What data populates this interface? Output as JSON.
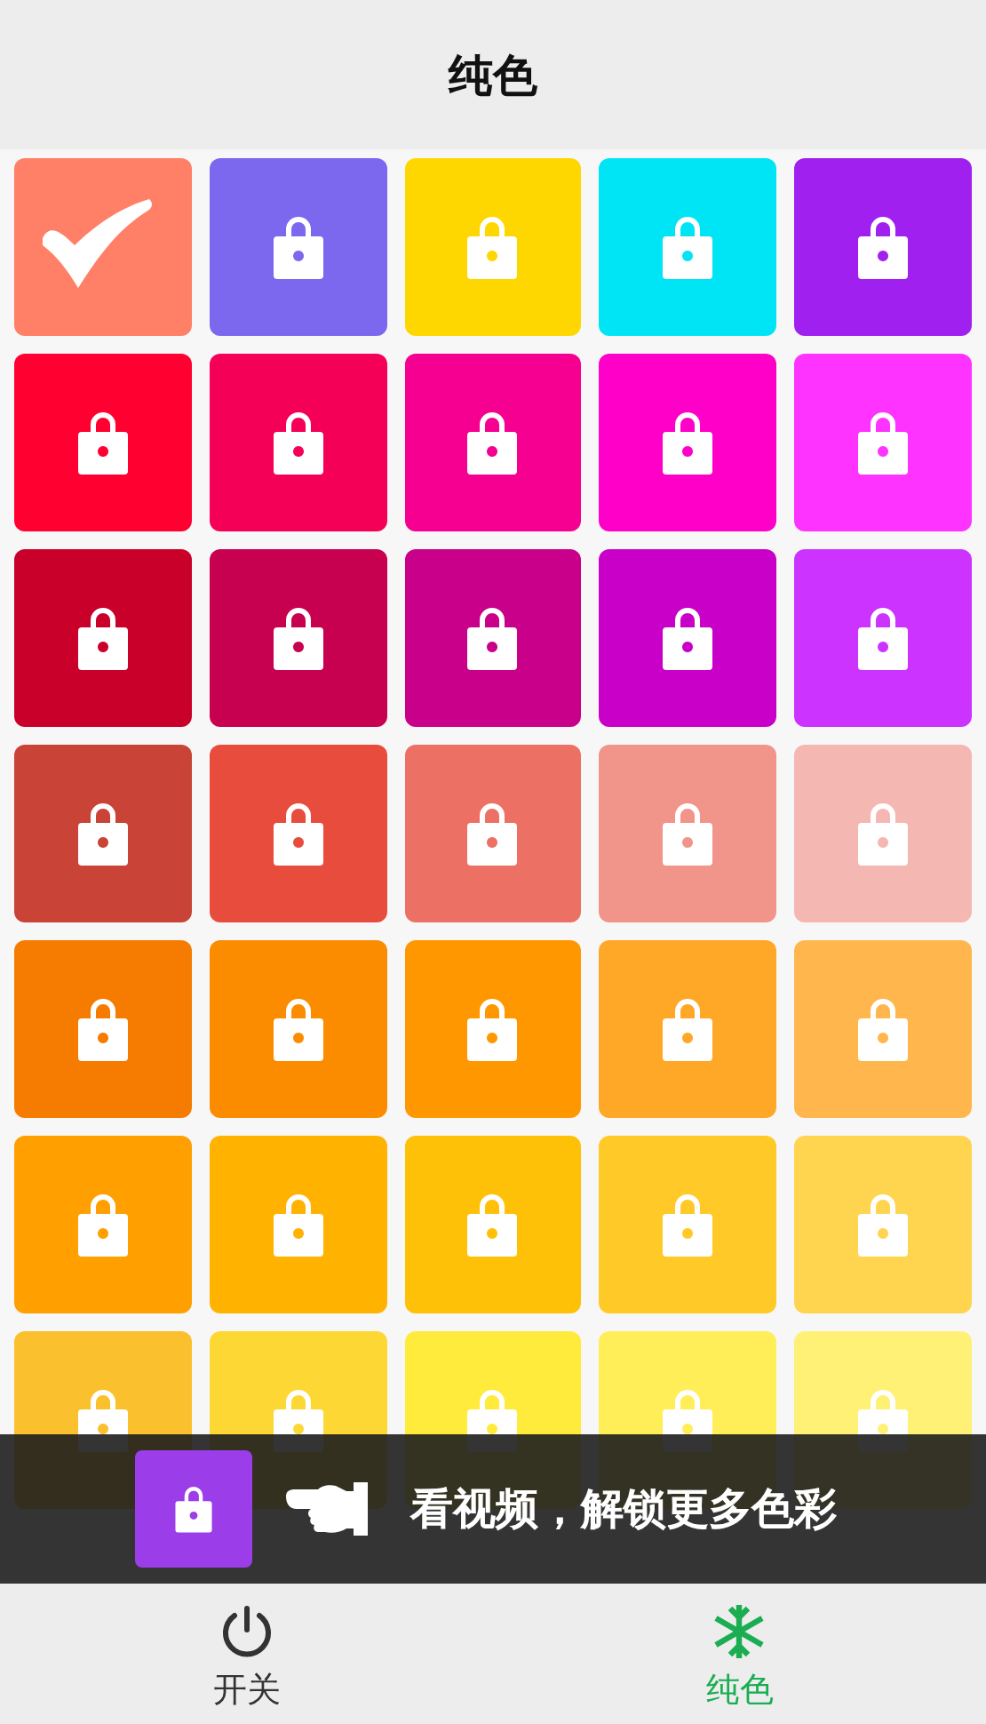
{
  "header": {
    "title": "纯色"
  },
  "tiles": [
    {
      "color": "#ff7f67",
      "selected": true
    },
    {
      "color": "#7b68ee",
      "selected": false
    },
    {
      "color": "#ffd700",
      "selected": false
    },
    {
      "color": "#00e5f5",
      "selected": false
    },
    {
      "color": "#a020f0",
      "selected": false
    },
    {
      "color": "#ff0030",
      "selected": false
    },
    {
      "color": "#f50057",
      "selected": false
    },
    {
      "color": "#f50090",
      "selected": false
    },
    {
      "color": "#ff00c8",
      "selected": false
    },
    {
      "color": "#ff33ff",
      "selected": false
    },
    {
      "color": "#c8002a",
      "selected": false
    },
    {
      "color": "#c80050",
      "selected": false
    },
    {
      "color": "#c8008a",
      "selected": false
    },
    {
      "color": "#c800c8",
      "selected": false
    },
    {
      "color": "#cc33ff",
      "selected": false
    },
    {
      "color": "#c94336",
      "selected": false
    },
    {
      "color": "#e84c3d",
      "selected": false
    },
    {
      "color": "#ec7063",
      "selected": false
    },
    {
      "color": "#f1948a",
      "selected": false
    },
    {
      "color": "#f5b7b1",
      "selected": false
    },
    {
      "color": "#f57c00",
      "selected": false
    },
    {
      "color": "#fb8c00",
      "selected": false
    },
    {
      "color": "#ff9800",
      "selected": false
    },
    {
      "color": "#ffa726",
      "selected": false
    },
    {
      "color": "#ffb74d",
      "selected": false
    },
    {
      "color": "#ffa000",
      "selected": false
    },
    {
      "color": "#ffb300",
      "selected": false
    },
    {
      "color": "#ffc107",
      "selected": false
    },
    {
      "color": "#ffca28",
      "selected": false
    },
    {
      "color": "#ffd54f",
      "selected": false
    },
    {
      "color": "#fbc02d",
      "selected": false
    },
    {
      "color": "#fdd835",
      "selected": false
    },
    {
      "color": "#ffeb3b",
      "selected": false
    },
    {
      "color": "#ffee58",
      "selected": false
    },
    {
      "color": "#fff176",
      "selected": false
    }
  ],
  "unlock_banner": {
    "text": "看视频，解锁更多色彩"
  },
  "tab_bar": [
    {
      "kind": "power",
      "label": "开关",
      "selected": false
    },
    {
      "kind": "snowflake",
      "label": "纯色",
      "selected": true
    }
  ]
}
